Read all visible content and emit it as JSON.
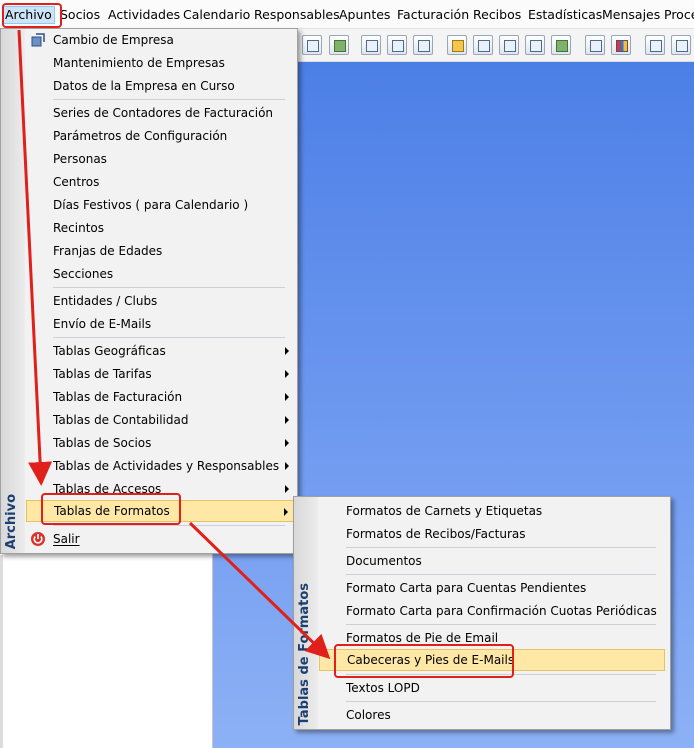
{
  "menubar": {
    "items": [
      "Archivo",
      "Socios",
      "Actividades",
      "Calendario",
      "Responsables",
      "Apuntes",
      "Facturación",
      "Recibos",
      "Estadísticas",
      "Mensajes",
      "Proce"
    ]
  },
  "archivo_menu": {
    "sidebar_label": "Archivo",
    "items": [
      "Cambio de Empresa",
      "Mantenimiento de Empresas",
      "Datos de la Empresa en Curso",
      "Series de Contadores de Facturación",
      "Parámetros de Configuración",
      "Personas",
      "Centros",
      "Días Festivos ( para Calendario )",
      "Recintos",
      "Franjas de Edades",
      "Secciones",
      "Entidades / Clubs",
      "Envío de E-Mails",
      "Tablas Geográficas",
      "Tablas de Tarifas",
      "Tablas de Facturación",
      "Tablas de Contabilidad",
      "Tablas de Socios",
      "Tablas de Actividades y Responsables",
      "Tablas de Accesos",
      "Tablas de Formatos",
      "Salir"
    ]
  },
  "formatos_menu": {
    "sidebar_label": "Tablas de Formatos",
    "items": [
      "Formatos de Carnets y Etiquetas",
      "Formatos de Recibos/Facturas",
      "Documentos",
      "Formato Carta para Cuentas Pendientes",
      "Formato Carta para Confirmación Cuotas Periódicas",
      "Formatos de Pie de Email",
      "Cabeceras y Pies de E-Mails",
      "Textos LOPD",
      "Colores"
    ]
  },
  "colors": {
    "highlight": "#ffe8a6",
    "annotation": "#e0201a",
    "desktop": "#4c7fe6"
  }
}
